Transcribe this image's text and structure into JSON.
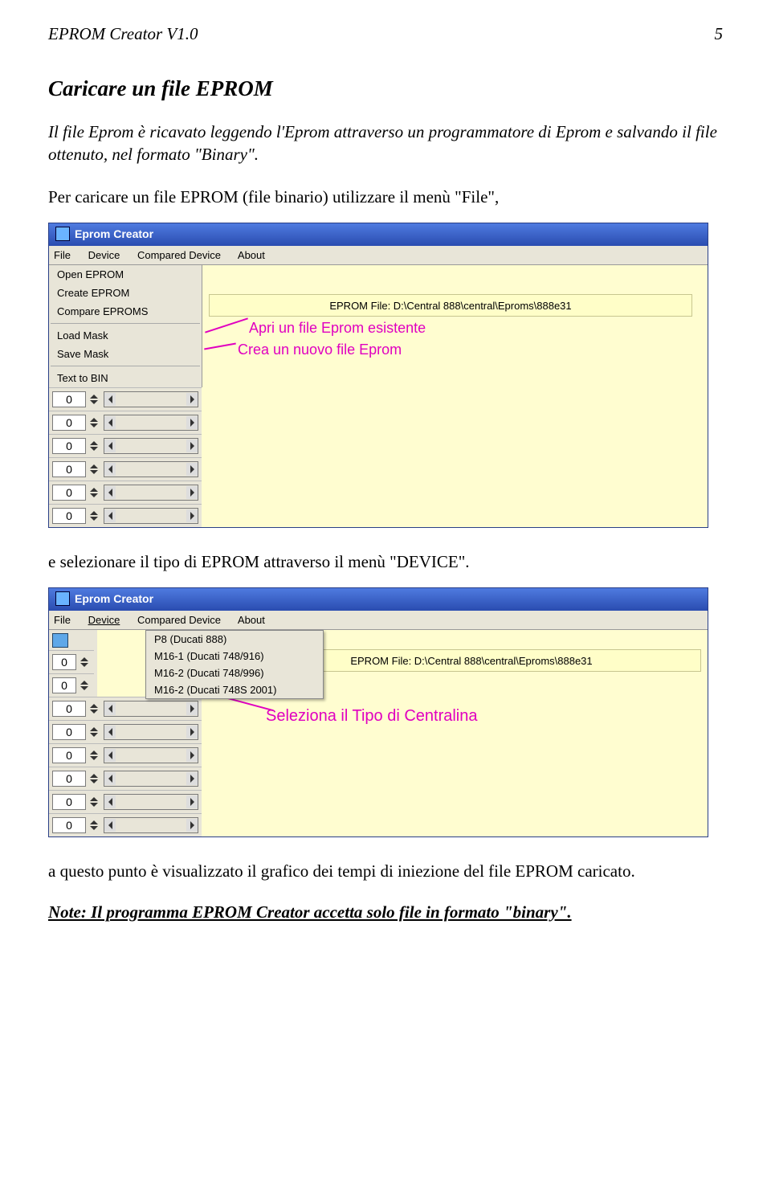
{
  "header": {
    "title": "EPROM Creator V1.0",
    "page": "5"
  },
  "section_title": "Caricare un file EPROM",
  "intro": "Il file Eprom è ricavato leggendo l'Eprom attraverso un programmatore di Eprom e salvando il file ottenuto, nel formato \"Binary\".",
  "lead1": "Per caricare un file EPROM (file binario) utilizzare il menù \"File\",",
  "screenshot1": {
    "title": "Eprom Creator",
    "menubar": [
      "File",
      "Device",
      "Compared Device",
      "About"
    ],
    "file_menu": {
      "open": "Open EPROM",
      "create": "Create EPROM",
      "compare": "Compare EPROMS",
      "load_mask": "Load Mask",
      "save_mask": "Save Mask",
      "text_to_bin": "Text to BIN"
    },
    "eprom_path": "EPROM File: D:\\Central 888\\central\\Eproms\\888e31",
    "annotations": {
      "open": "Apri un file Eprom esistente",
      "create": "Crea un nuovo file Eprom"
    },
    "spinner_value": "0"
  },
  "lead2": "e selezionare il tipo di EPROM attraverso il menù \"DEVICE\".",
  "screenshot2": {
    "title": "Eprom Creator",
    "menubar": [
      "File",
      "Device",
      "Compared Device",
      "About"
    ],
    "device_menu": {
      "d1": "P8 (Ducati 888)",
      "d2": "M16-1 (Ducati 748/916)",
      "d3": "M16-2 (Ducati 748/996)",
      "d4": "M16-2 (Ducati 748S 2001)"
    },
    "eprom_path": "EPROM File: D:\\Central 888\\central\\Eproms\\888e31",
    "annotation": "Seleziona il Tipo di Centralina",
    "spinner_value": "0"
  },
  "closing": "a questo punto è visualizzato il grafico dei tempi di iniezione del file EPROM caricato.",
  "note": "Note: Il programma EPROM Creator accetta solo file in formato \"binary\"."
}
